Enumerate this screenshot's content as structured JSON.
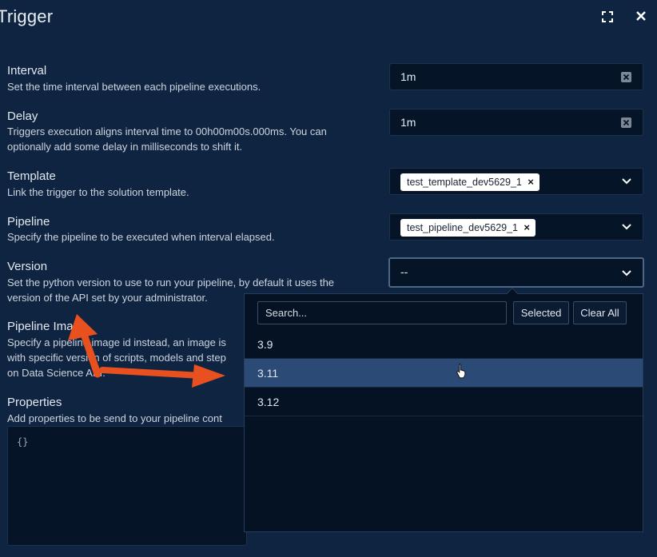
{
  "window": {
    "title": "Trigger"
  },
  "fields": {
    "interval": {
      "label": "Interval",
      "help": "Set the time interval between each pipeline executions.",
      "value": "1m"
    },
    "delay": {
      "label": "Delay",
      "help_line1": "Triggers execution aligns interval time to 00h00m00s.000ms. You can",
      "help_line2": "optionally add some delay in milliseconds to shift it.",
      "value": "1m"
    },
    "template": {
      "label": "Template",
      "help": "Link the trigger to the solution template.",
      "chip": "test_template_dev5629_1"
    },
    "pipeline": {
      "label": "Pipeline",
      "help": "Specify the pipeline to be executed when interval elapsed.",
      "chip": "test_pipeline_dev5629_1"
    },
    "version": {
      "label": "Version",
      "help_line1": "Set the python version to use to run your pipeline, by default it uses the",
      "help_line2": "version of the API set by your administrator.",
      "value": "--"
    },
    "pipeline_image": {
      "label": "Pipeline Image",
      "help_line1": "Specify a pipeline image id instead, an image is",
      "help_line2": "with specific version of scripts, models and step",
      "help_line3": "on Data Science API."
    },
    "properties": {
      "label": "Properties",
      "help": "Add properties to be send to your pipeline cont",
      "value": "{}"
    }
  },
  "version_dropdown": {
    "search_placeholder": "Search...",
    "selected_button": "Selected",
    "clear_all_button": "Clear All",
    "options": [
      "3.9",
      "3.11",
      "3.12"
    ],
    "highlighted_option": "3.11"
  },
  "annotation": {
    "arrow_color": "#e8501f"
  },
  "icons": [
    "expand-icon",
    "close-icon",
    "clear-icon",
    "chevron-down-icon",
    "hand-cursor-icon"
  ]
}
